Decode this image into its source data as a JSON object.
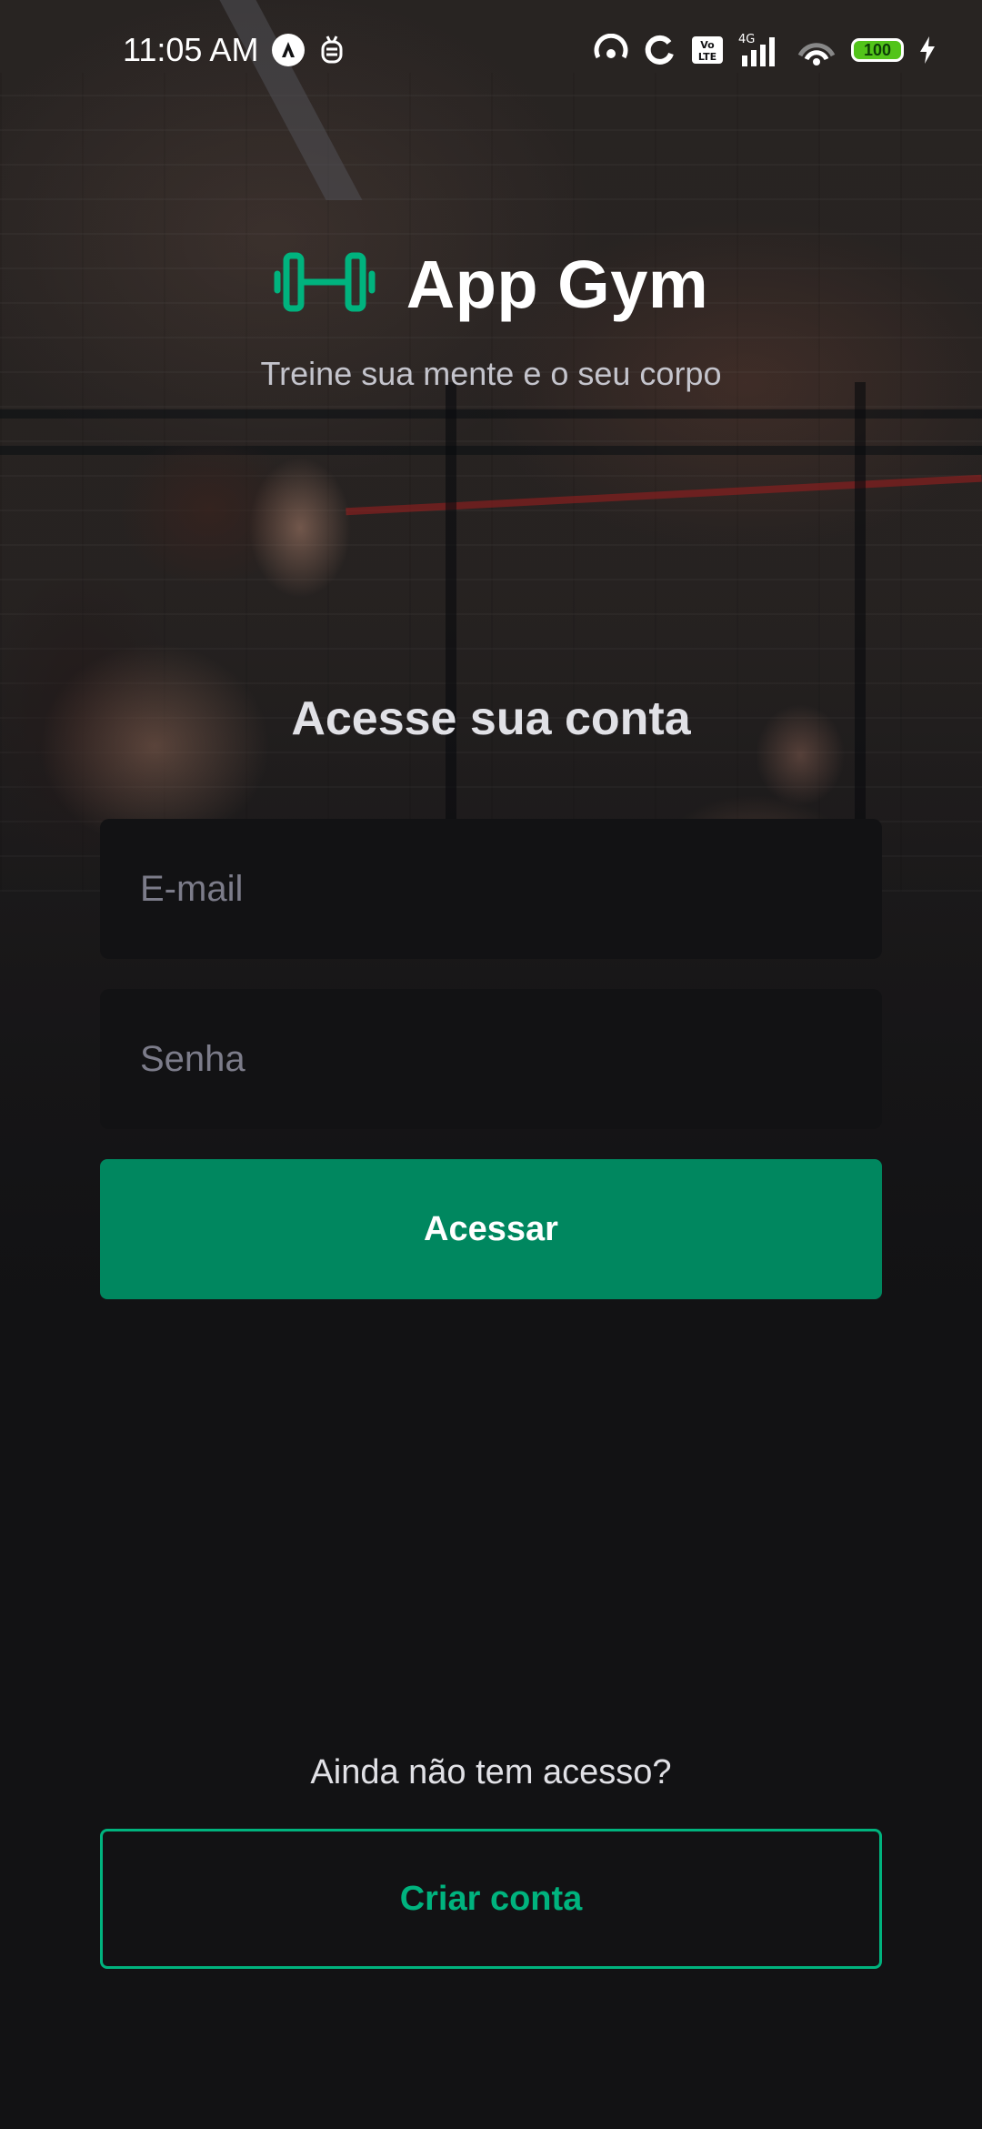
{
  "status_bar": {
    "time": "11:05 AM",
    "battery_level": "100",
    "network": "4G",
    "volte": "Vo LTE"
  },
  "header": {
    "logo_icon": "dumbbell-icon",
    "app_name": "App Gym",
    "tagline": "Treine sua mente e o seu corpo"
  },
  "login": {
    "title": "Acesse sua conta",
    "email_placeholder": "E-mail",
    "password_placeholder": "Senha",
    "submit_label": "Acessar"
  },
  "signup": {
    "question": "Ainda não tem acesso?",
    "create_label": "Criar conta"
  },
  "colors": {
    "background": "#121214",
    "input_background": "#121214",
    "primary_button": "#00875F",
    "accent": "#00B37E",
    "placeholder": "#7C7C8A"
  }
}
